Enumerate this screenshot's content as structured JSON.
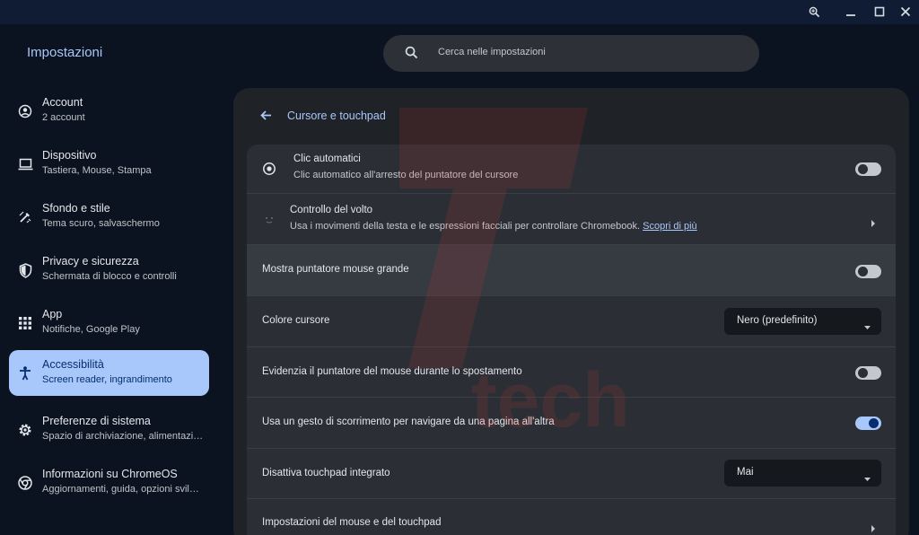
{
  "app_title": "Impostazioni",
  "search": {
    "placeholder": "Cerca nelle impostazioni"
  },
  "sidebar": {
    "items": [
      {
        "title": "Account",
        "subtitle": "2 account"
      },
      {
        "title": "Dispositivo",
        "subtitle": "Tastiera, Mouse, Stampa"
      },
      {
        "title": "Sfondo e stile",
        "subtitle": "Tema scuro, salvaschermo"
      },
      {
        "title": "Privacy e sicurezza",
        "subtitle": "Schermata di blocco e controlli"
      },
      {
        "title": "App",
        "subtitle": "Notifiche, Google Play"
      },
      {
        "title": "Accessibilità",
        "subtitle": "Screen reader, ingrandimento",
        "active": true
      },
      {
        "title": "Preferenze di sistema",
        "subtitle": "Spazio di archiviazione, alimentazione, lingua"
      },
      {
        "title": "Informazioni su ChromeOS",
        "subtitle": "Aggiornamenti, guida, opzioni sviluppatore"
      }
    ]
  },
  "page": {
    "title": "Cursore e touchpad",
    "rows": {
      "autoclick": {
        "title": "Clic automatici",
        "subtitle": "Clic automatico all'arresto del puntatore del cursore",
        "enabled": false
      },
      "face_control": {
        "title": "Controllo del volto",
        "subtitle": "Usa i movimenti della testa e le espressioni facciali per controllare Chromebook.",
        "link": "Scopri di più"
      },
      "large_pointer": {
        "title": "Mostra puntatore mouse grande",
        "enabled": false
      },
      "cursor_color": {
        "title": "Colore cursore",
        "value": "Nero (predefinito)"
      },
      "highlight_pointer": {
        "title": "Evidenzia il puntatore del mouse durante lo spostamento",
        "enabled": false
      },
      "swipe_nav": {
        "title": "Usa un gesto di scorrimento per navigare da una pagina all'altra",
        "enabled": true
      },
      "disable_touchpad": {
        "title": "Disattiva touchpad integrato",
        "value": "Mai"
      },
      "mouse_settings": {
        "title": "Impostazioni del mouse e del touchpad"
      }
    }
  },
  "watermark": {
    "text": "tech"
  },
  "colors": {
    "accent": "#a8c7fa",
    "background": "#0c1320",
    "panel": "#1f2227",
    "card": "#2b2f35",
    "watermark": "#c0392b"
  },
  "icons": {
    "search": "search-icon",
    "zoom": "zoom-icon",
    "minimize": "minimize-icon",
    "maximize": "maximize-icon",
    "close": "close-icon",
    "account": "account-icon",
    "device": "laptop-icon",
    "style": "brush-icon",
    "privacy": "shield-icon",
    "apps": "apps-grid-icon",
    "accessibility": "accessibility-icon",
    "system": "gear-icon",
    "about": "chrome-icon",
    "back": "back-arrow-icon"
  }
}
